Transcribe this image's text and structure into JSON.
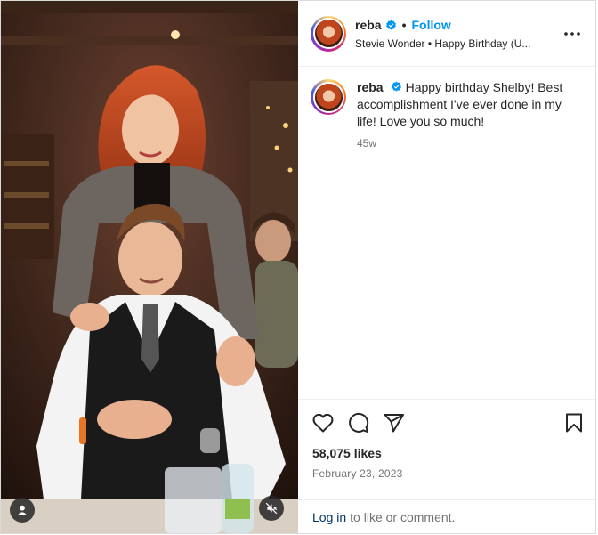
{
  "post": {
    "username": "reba",
    "follow_label": "Follow",
    "dot": "•",
    "audio": "Stevie Wonder • Happy Birthday (U...",
    "caption_text": "Happy birthday Shelby! Best accomplishment I've ever done in my life! Love you so much!",
    "caption_time": "45w",
    "likes": "58,075 likes",
    "date": "February 23, 2023",
    "login_link": "Log in",
    "login_rest": "to like or comment."
  },
  "icons": {
    "verified": "verified-badge-icon",
    "more": "more-options-icon",
    "like": "heart-icon",
    "comment": "comment-icon",
    "share": "share-icon",
    "save": "bookmark-icon",
    "tag": "user-tag-icon",
    "mute": "mute-icon"
  },
  "colors": {
    "accent": "#0095f6",
    "link": "#00376b",
    "muted_text": "#737373",
    "border": "#dbdbdb"
  }
}
